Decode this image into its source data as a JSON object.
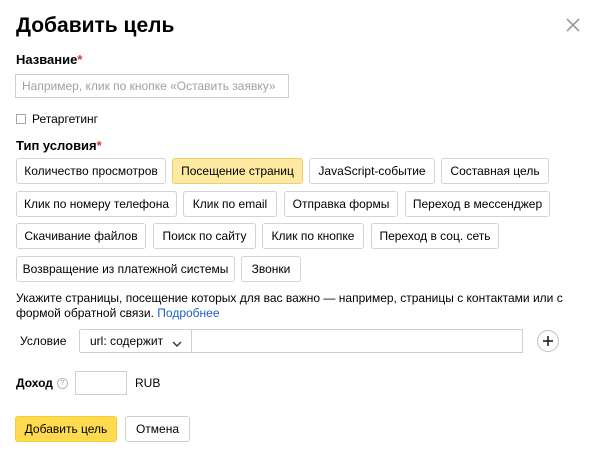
{
  "dialog": {
    "title": "Добавить цель",
    "close_icon": "close-icon"
  },
  "name_field": {
    "label": "Название",
    "required_mark": "*",
    "placeholder": "Например, клик по кнопке «Оставить заявку»",
    "value": ""
  },
  "retargeting": {
    "label": "Ретаргетинг",
    "checked": false
  },
  "condition_type": {
    "label": "Тип условия",
    "required_mark": "*",
    "selected_index": 1,
    "options": [
      "Количество просмотров",
      "Посещение страниц",
      "JavaScript-событие",
      "Составная цель",
      "Клик по номеру телефона",
      "Клик по email",
      "Отправка формы",
      "Переход в мессенджер",
      "Скачивание файлов",
      "Поиск по сайту",
      "Клик по кнопке",
      "Переход в соц. сеть",
      "Возвращение из платежной системы",
      "Звонки"
    ]
  },
  "hint": {
    "text": "Укажите страницы, посещение которых для вас важно — например, страницы с контактами или с формой обратной связи.",
    "link": "Подробнее"
  },
  "condition": {
    "label": "Условие",
    "select_value": "url: содержит",
    "input_value": "",
    "add_icon": "plus-icon"
  },
  "income": {
    "label": "Доход",
    "help_icon": "question-icon",
    "value": "",
    "currency": "RUB"
  },
  "actions": {
    "submit": "Добавить цель",
    "cancel": "Отмена"
  },
  "colors": {
    "accent": "#ffdb4d",
    "selected_chip": "#fde9a0",
    "required": "#e03030",
    "link": "#1a5ec9"
  }
}
